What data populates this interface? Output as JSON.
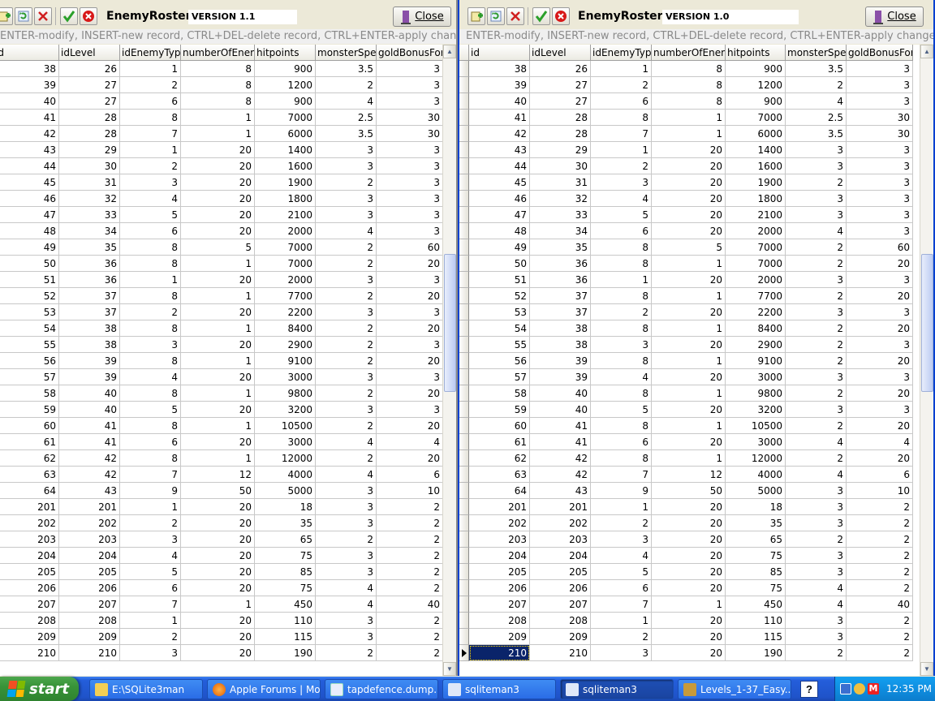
{
  "left_window": {
    "title": "EnemyRoster",
    "version": "VERSION 1.1",
    "close_label": "Close",
    "hint": "ENTER-modify, INSERT-new record, CTRL+DEL-delete record, CTRL+ENTER-apply changes, ESCAPE-discard changes"
  },
  "right_window": {
    "title": "EnemyRoster",
    "version": "VERSION 1.0",
    "close_label": "Close",
    "hint": "ENTER-modify, INSERT-new record, CTRL+DEL-delete record, CTRL+ENTER-apply changes, ESCAPE-discard changes"
  },
  "columns": [
    "id",
    "idLevel",
    "idEnemyType",
    "numberOfEnemies",
    "hitpoints",
    "monsterSpeed",
    "goldBonusForKill"
  ],
  "rows": [
    [
      "38",
      "26",
      "1",
      "8",
      "900",
      "3.5",
      "3"
    ],
    [
      "39",
      "27",
      "2",
      "8",
      "1200",
      "2",
      "3"
    ],
    [
      "40",
      "27",
      "6",
      "8",
      "900",
      "4",
      "3"
    ],
    [
      "41",
      "28",
      "8",
      "1",
      "7000",
      "2.5",
      "30"
    ],
    [
      "42",
      "28",
      "7",
      "1",
      "6000",
      "3.5",
      "30"
    ],
    [
      "43",
      "29",
      "1",
      "20",
      "1400",
      "3",
      "3"
    ],
    [
      "44",
      "30",
      "2",
      "20",
      "1600",
      "3",
      "3"
    ],
    [
      "45",
      "31",
      "3",
      "20",
      "1900",
      "2",
      "3"
    ],
    [
      "46",
      "32",
      "4",
      "20",
      "1800",
      "3",
      "3"
    ],
    [
      "47",
      "33",
      "5",
      "20",
      "2100",
      "3",
      "3"
    ],
    [
      "48",
      "34",
      "6",
      "20",
      "2000",
      "4",
      "3"
    ],
    [
      "49",
      "35",
      "8",
      "5",
      "7000",
      "2",
      "60"
    ],
    [
      "50",
      "36",
      "8",
      "1",
      "7000",
      "2",
      "20"
    ],
    [
      "51",
      "36",
      "1",
      "20",
      "2000",
      "3",
      "3"
    ],
    [
      "52",
      "37",
      "8",
      "1",
      "7700",
      "2",
      "20"
    ],
    [
      "53",
      "37",
      "2",
      "20",
      "2200",
      "3",
      "3"
    ],
    [
      "54",
      "38",
      "8",
      "1",
      "8400",
      "2",
      "20"
    ],
    [
      "55",
      "38",
      "3",
      "20",
      "2900",
      "2",
      "3"
    ],
    [
      "56",
      "39",
      "8",
      "1",
      "9100",
      "2",
      "20"
    ],
    [
      "57",
      "39",
      "4",
      "20",
      "3000",
      "3",
      "3"
    ],
    [
      "58",
      "40",
      "8",
      "1",
      "9800",
      "2",
      "20"
    ],
    [
      "59",
      "40",
      "5",
      "20",
      "3200",
      "3",
      "3"
    ],
    [
      "60",
      "41",
      "8",
      "1",
      "10500",
      "2",
      "20"
    ],
    [
      "61",
      "41",
      "6",
      "20",
      "3000",
      "4",
      "4"
    ],
    [
      "62",
      "42",
      "8",
      "1",
      "12000",
      "2",
      "20"
    ],
    [
      "63",
      "42",
      "7",
      "12",
      "4000",
      "4",
      "6"
    ],
    [
      "64",
      "43",
      "9",
      "50",
      "5000",
      "3",
      "10"
    ],
    [
      "201",
      "201",
      "1",
      "20",
      "18",
      "3",
      "2"
    ],
    [
      "202",
      "202",
      "2",
      "20",
      "35",
      "3",
      "2"
    ],
    [
      "203",
      "203",
      "3",
      "20",
      "65",
      "2",
      "2"
    ],
    [
      "204",
      "204",
      "4",
      "20",
      "75",
      "3",
      "2"
    ],
    [
      "205",
      "205",
      "5",
      "20",
      "85",
      "3",
      "2"
    ],
    [
      "206",
      "206",
      "6",
      "20",
      "75",
      "4",
      "2"
    ],
    [
      "207",
      "207",
      "7",
      "1",
      "450",
      "4",
      "40"
    ],
    [
      "208",
      "208",
      "1",
      "20",
      "110",
      "3",
      "2"
    ],
    [
      "209",
      "209",
      "2",
      "20",
      "115",
      "3",
      "2"
    ],
    [
      "210",
      "210",
      "3",
      "20",
      "190",
      "2",
      "2"
    ]
  ],
  "taskbar": {
    "start_label": "start",
    "tasks": [
      "E:\\SQLite3man",
      "Apple Forums | Mo...",
      "tapdefence.dump....",
      "sqliteman3",
      "sqliteman3",
      "Levels_1-37_Easy...."
    ],
    "help_label": "?",
    "clock": "12:35 PM"
  }
}
